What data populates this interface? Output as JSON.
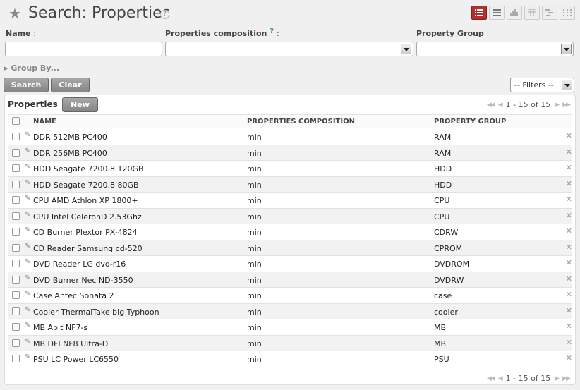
{
  "page": {
    "title": "Search: Properties",
    "help": "?"
  },
  "search": {
    "name_label": "Name",
    "composition_label": "Properties composition",
    "composition_help": "?",
    "group_label": "Property Group",
    "colon": ":",
    "name_value": "",
    "composition_value": "",
    "group_value": "",
    "group_by_label": "Group By...",
    "search_button": "Search",
    "clear_button": "Clear",
    "filters_value": "-- Filters --"
  },
  "list": {
    "title": "Properties",
    "new_button": "New",
    "pager_top": "1 - 15 of 15",
    "pager_bottom": "1 - 15 of 15",
    "columns": [
      "NAME",
      "PROPERTIES COMPOSITION",
      "PROPERTY GROUP"
    ],
    "rows": [
      {
        "name": "DDR 512MB PC400",
        "composition": "min",
        "group": "RAM"
      },
      {
        "name": "DDR 256MB PC400",
        "composition": "min",
        "group": "RAM"
      },
      {
        "name": "HDD Seagate 7200.8 120GB",
        "composition": "min",
        "group": "HDD"
      },
      {
        "name": "HDD Seagate 7200.8 80GB",
        "composition": "min",
        "group": "HDD"
      },
      {
        "name": "CPU AMD Athlon XP 1800+",
        "composition": "min",
        "group": "CPU"
      },
      {
        "name": "CPU Intel CeleronD 2.53Ghz",
        "composition": "min",
        "group": "CPU"
      },
      {
        "name": "CD Burner Plextor PX-4824",
        "composition": "min",
        "group": "CDRW"
      },
      {
        "name": "CD Reader Samsung cd-520",
        "composition": "min",
        "group": "CPROM"
      },
      {
        "name": "DVD Reader LG dvd-r16",
        "composition": "min",
        "group": "DVDROM"
      },
      {
        "name": "DVD Burner Nec ND-3550",
        "composition": "min",
        "group": "DVDRW"
      },
      {
        "name": "Case Antec Sonata 2",
        "composition": "min",
        "group": "case"
      },
      {
        "name": "Cooler ThermalTake big Typhoon",
        "composition": "min",
        "group": "cooler"
      },
      {
        "name": "MB Abit NF7-s",
        "composition": "min",
        "group": "MB"
      },
      {
        "name": "MB DFI NF8 Ultra-D",
        "composition": "min",
        "group": "MB"
      },
      {
        "name": "PSU LC Power LC6550",
        "composition": "min",
        "group": "PSU"
      }
    ]
  },
  "icons": {
    "favorite": "star-icon",
    "views": [
      "list-view-icon",
      "form-view-icon",
      "graph-view-icon",
      "calendar-view-icon",
      "gantt-view-icon",
      "diagram-view-icon"
    ],
    "row_edit": "pencil-icon",
    "row_delete": "delete-icon"
  },
  "colors": {
    "active_view": "#b03030",
    "button": "#8f8f8f",
    "help_green": "#3a9a3a"
  }
}
